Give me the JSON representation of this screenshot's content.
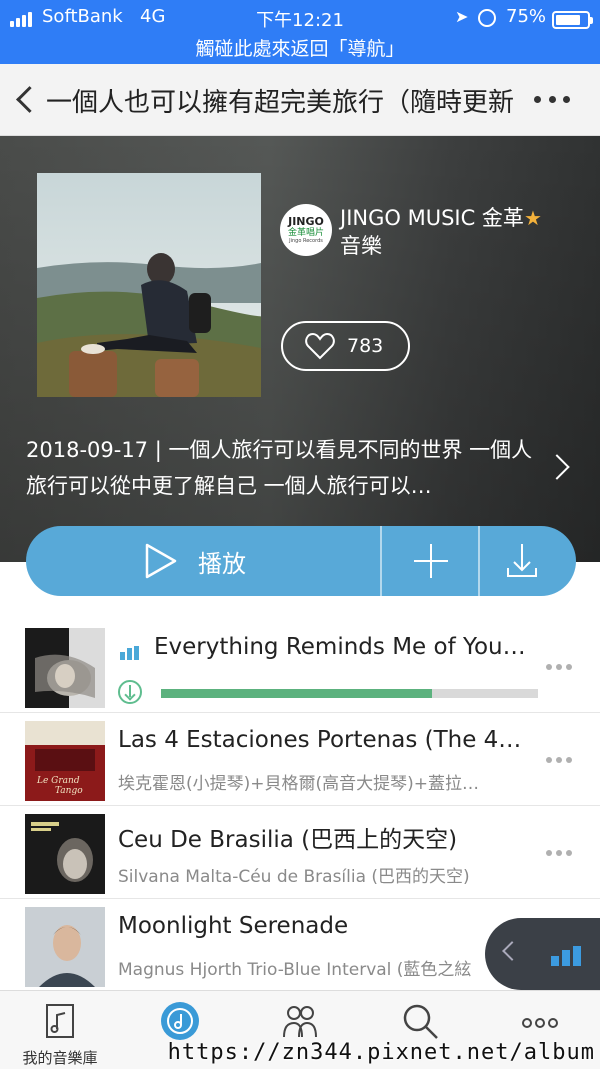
{
  "status_bar": {
    "carrier": "SoftBank",
    "network": "4G",
    "time": "下午12:21",
    "battery": "75%",
    "return_banner": "觸碰此處來返回「導航」"
  },
  "nav": {
    "title": "一個人也可以擁有超完美旅行（隨時更新"
  },
  "album": {
    "artist_logo_line1": "JINGO",
    "artist_logo_line2": "金革唱片",
    "artist_logo_line3": "Jingo Records",
    "artist_name": "JINGO MUSIC 金革",
    "artist_name_line2": "音樂",
    "likes": "783",
    "description": "2018-09-17 | 一個人旅行可以看見不同的世界 一個人旅行可以從中更了解自己 一個人旅行可以…"
  },
  "play_bar": {
    "play_label": "播放"
  },
  "songs": [
    {
      "title": "Everything Reminds Me of You…",
      "download_progress": 0.72,
      "playing": true
    },
    {
      "title": "Las 4 Estaciones Portenas (The 4…",
      "subtitle": "埃克霍恩(小提琴)+貝格爾(高音大提琴)+蓋拉…"
    },
    {
      "title": "Ceu De Brasilia (巴西上的天空)",
      "subtitle": "Silvana Malta-Céu de Brasília (巴西的天空)"
    },
    {
      "title": "Moonlight Serenade",
      "subtitle": "Magnus Hjorth Trio-Blue Interval (藍色之絃"
    }
  ],
  "tabs": [
    {
      "label": "我的音樂庫",
      "icon": "music-library-icon"
    },
    {
      "label": "",
      "icon": "discover-icon",
      "active": true
    },
    {
      "label": "",
      "icon": "friends-icon"
    },
    {
      "label": "",
      "icon": "search-icon"
    },
    {
      "label": "",
      "icon": "more-icon"
    }
  ],
  "watermark": "https://zn344.pixnet.net/album",
  "colors": {
    "status_blue": "#2f7df6",
    "accent_blue": "#58a9d8",
    "progress_green": "#5cb27e",
    "star_gold": "#f3b13b"
  }
}
